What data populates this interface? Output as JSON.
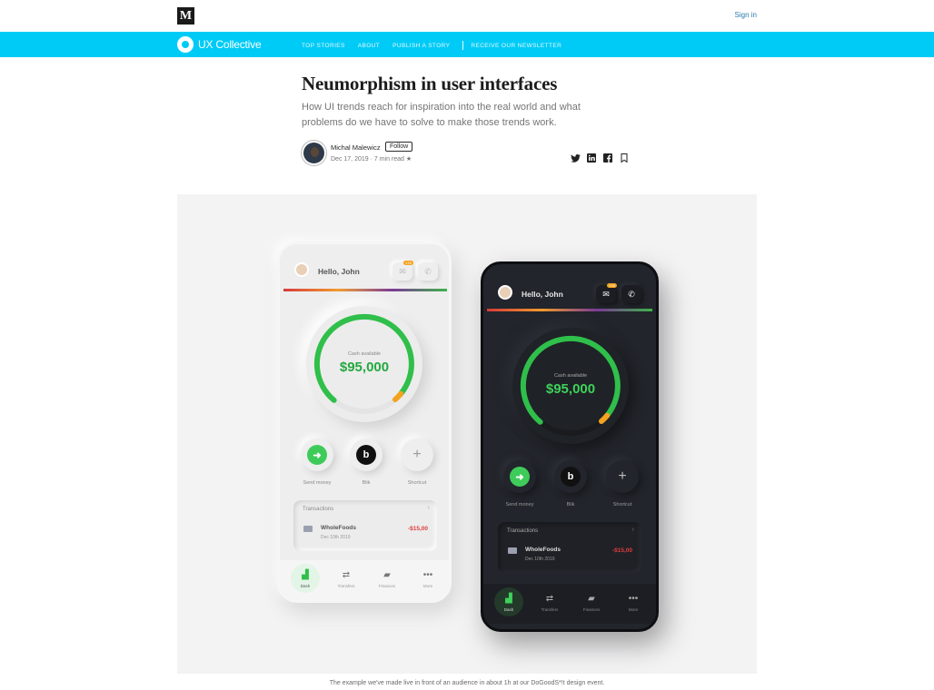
{
  "medium": {
    "logo": "M",
    "signin": "Sign in"
  },
  "publication": {
    "name": "UX Collective",
    "nav": [
      "TOP STORIES",
      "ABOUT",
      "PUBLISH A STORY",
      "RECEIVE OUR NEWSLETTER"
    ]
  },
  "article": {
    "title": "Neumorphism in user interfaces",
    "subtitle": "How UI trends reach for inspiration into the real world and what problems do we have to solve to make those trends work.",
    "author": "Michal Malewicz",
    "follow": "Follow",
    "meta": "Dec 17, 2019 · 7 min read ★",
    "share_icons": [
      "twitter-icon",
      "linkedin-icon",
      "facebook-icon",
      "bookmark-icon"
    ]
  },
  "mockup": {
    "greeting": "Hello, John",
    "badge": "178",
    "cash_label": "Cash available",
    "cash_value": "$95,000",
    "actions": [
      "Send money",
      "Blik",
      "Shortcut"
    ],
    "transactions_title": "Transactions",
    "transaction": {
      "name": "WholeFoods",
      "date": "Dec 10th 2019",
      "amount": "-$15,00"
    },
    "tabs": [
      "Dash",
      "Transfers",
      "Finances",
      "More"
    ]
  },
  "caption": "The example we've made live in front of an audience in about 1h at our DoGoodS*!t design event.",
  "colors": {
    "accent": "#00cbf7",
    "green": "#2fbf4a",
    "orange": "#f4a31f",
    "red": "#e03c3c"
  }
}
